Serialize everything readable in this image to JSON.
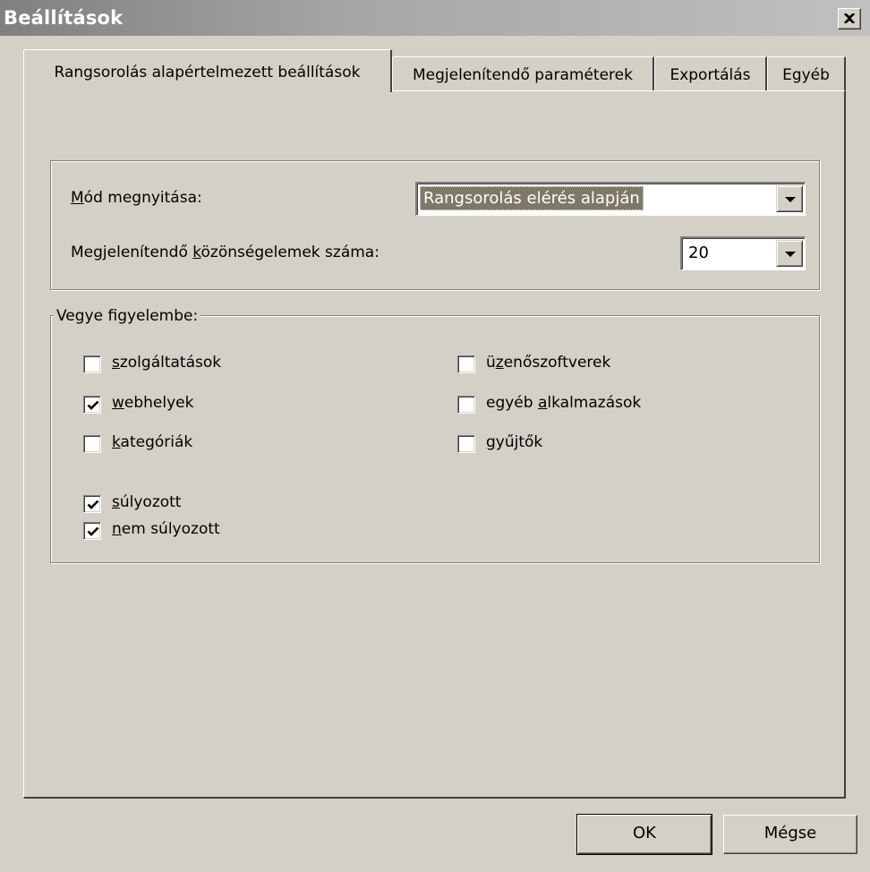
{
  "window": {
    "title": "Beállítások",
    "close_icon": "close-icon"
  },
  "tabs": [
    {
      "label": "Rangsorolás alapértelmezett beállítások",
      "active": true
    },
    {
      "label": "Megjelenítendő paraméterek",
      "active": false
    },
    {
      "label": "Exportálás",
      "active": false
    },
    {
      "label": "Egyéb",
      "active": false
    }
  ],
  "settings": {
    "open_mode": {
      "label_mnemonic": "M",
      "label_rest": "ód megnyitása:",
      "value": "Rangsorolás elérés alapján"
    },
    "item_count": {
      "label_pre": "Megjelenítendő ",
      "label_mnemonic": "k",
      "label_rest": "özönségelemek száma:",
      "value": "20"
    }
  },
  "consider": {
    "legend": "Vegye figyelembe:",
    "items": [
      {
        "mnemonic": "s",
        "rest": "zolgáltatások",
        "checked": false
      },
      {
        "mnemonic": "w",
        "rest": "ebhelyek",
        "checked": true
      },
      {
        "mnemonic": "k",
        "rest": "ategóriák",
        "checked": false
      },
      {
        "pre": "ü",
        "mnemonic": "z",
        "rest": "enőszoftverek",
        "checked": false
      },
      {
        "pre": "egyéb ",
        "mnemonic": "a",
        "rest": "lkalmazások",
        "checked": false
      },
      {
        "mnemonic": "g",
        "rest": "yűjtők",
        "checked": false
      },
      {
        "mnemonic": "s",
        "rest": "úlyozott",
        "checked": true
      },
      {
        "mnemonic": "n",
        "rest": "em súlyozott",
        "checked": true
      }
    ]
  },
  "buttons": {
    "ok": "OK",
    "cancel": "Mégse"
  }
}
